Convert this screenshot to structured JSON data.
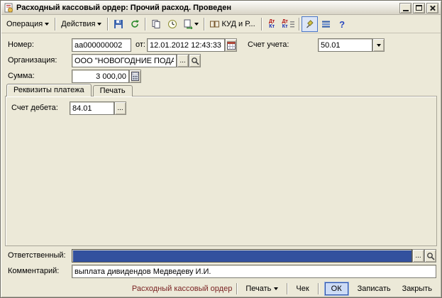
{
  "colors": {
    "selection_blue": "#33519E",
    "doc_type_text": "#7a2222",
    "dialog_background": "#ece9d8"
  },
  "window": {
    "title": "Расходный кассовый ордер: Прочий расход. Проведен"
  },
  "toolbar": {
    "operation": "Операция",
    "actions": "Действия",
    "kud": "КУД и Р...",
    "dt": "Дт",
    "kt": "Кт",
    "help": "?"
  },
  "glyphs": {
    "ellipsis": "..."
  },
  "form": {
    "number_label": "Номер:",
    "number_value": "аа000000002",
    "date_label": "от:",
    "date_value": "12.01.2012 12:43:33",
    "account_label": "Счет учета:",
    "account_value": "50.01",
    "org_label": "Организация:",
    "org_value": "ООО \"НОВОГОДНИЕ ПОДАРКИ\"",
    "sum_label": "Сумма:",
    "sum_value": "3 000,00",
    "tabs": [
      {
        "label": "Реквизиты платежа",
        "active": true
      },
      {
        "label": "Печать",
        "active": false
      }
    ],
    "debit_label": "Счет дебета:",
    "debit_value": "84.01",
    "responsible_label": "Ответственный:",
    "responsible_value": "",
    "comment_label": "Комментарий:",
    "comment_value": "выплата дивидендов Медведеву И.И."
  },
  "footer": {
    "doc_type": "Расходный кассовый ордер",
    "print": "Печать",
    "check": "Чек",
    "ok": "ОК",
    "write": "Записать",
    "close": "Закрыть"
  }
}
